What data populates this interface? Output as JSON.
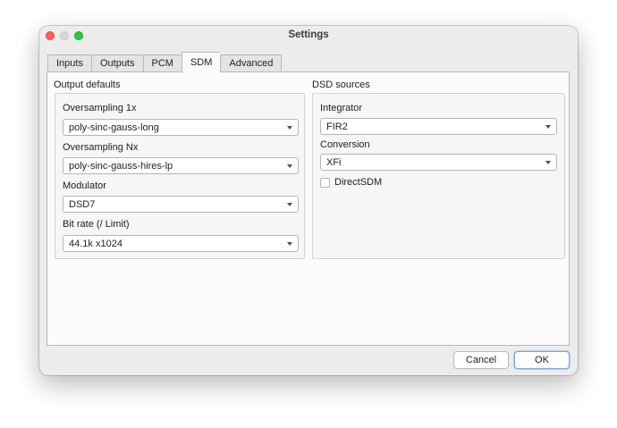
{
  "window": {
    "title": "Settings"
  },
  "tabs": [
    {
      "label": "Inputs",
      "active": false
    },
    {
      "label": "Outputs",
      "active": false
    },
    {
      "label": "PCM",
      "active": false
    },
    {
      "label": "SDM",
      "active": true
    },
    {
      "label": "Advanced",
      "active": false
    }
  ],
  "output_defaults": {
    "title": "Output defaults",
    "oversampling_1x": {
      "label": "Oversampling 1x",
      "value": "poly-sinc-gauss-long"
    },
    "oversampling_nx": {
      "label": "Oversampling Nx",
      "value": "poly-sinc-gauss-hires-lp"
    },
    "modulator": {
      "label": "Modulator",
      "value": "DSD7"
    },
    "bit_rate": {
      "label": "Bit rate (/ Limit)",
      "value": "44.1k x1024"
    }
  },
  "dsd_sources": {
    "title": "DSD sources",
    "integrator": {
      "label": "Integrator",
      "value": "FIR2"
    },
    "conversion": {
      "label": "Conversion",
      "value": "XFi"
    },
    "direct_sdm": {
      "label": "DirectSDM",
      "checked": false
    }
  },
  "buttons": {
    "cancel": "Cancel",
    "ok": "OK"
  },
  "colors": {
    "close": "#ff5f57",
    "minimize": "#d7d7d7",
    "maximize": "#28c840",
    "window_bg": "#ececec",
    "default_button_focus": "#7aa9df"
  }
}
